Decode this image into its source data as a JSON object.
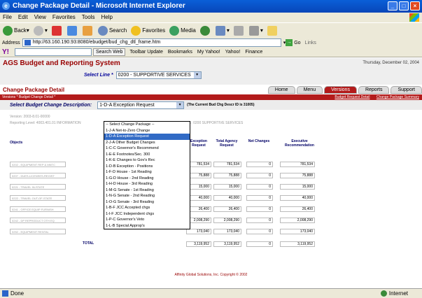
{
  "window": {
    "title": "Change Package Detail - Microsoft Internet Explorer"
  },
  "menu": [
    "File",
    "Edit",
    "View",
    "Favorites",
    "Tools",
    "Help"
  ],
  "toolbar": {
    "back": "Back",
    "search": "Search",
    "favorites": "Favorites",
    "media": "Media"
  },
  "address": {
    "label": "Address",
    "url": "http://63.160.190.93:8080/ebudget/bud_chg_dtl_frame.htm",
    "go": "Go",
    "links": "Links"
  },
  "yahoo": {
    "logo": "Y!",
    "search_web": "Search Web",
    "update": "Toolbar Update",
    "bookmarks": "Bookmarks",
    "my_yahoo": "My Yahoo!",
    "yahoo": "Yahoo!",
    "finance": "Finance"
  },
  "app": {
    "title": "AGS Budget and Reporting System",
    "date": "Thursday, December 02, 2004",
    "select_line_label": "Select Line *",
    "select_line_value": "0200 - SUPPORTIVE SERVICES",
    "page_title": "Change Package Detail",
    "tabs": [
      "Home",
      "Menu",
      "Versions",
      "Reports",
      "Support"
    ],
    "breadcrumb": "Versions * Budget Change Detail *",
    "links": [
      "Budget Request Detail",
      "Change Package Summary"
    ],
    "sbcd_label": "Select Budget Change Description:",
    "sbcd_value": "1-D-A Exception Request",
    "sbcd_note": "(The Current Bud Chg Descr ID is 31005)",
    "version": "Version: 2003-8.01-00000",
    "reporting_level": "Reporting Level: 4003.401.01  INFORMATION",
    "service_text": "E: 0200 SUPPORTIVE SERVICES",
    "col_objects": "Objects",
    "col_exception": "Exception Request",
    "col_total_agency": "Total Agency Request",
    "col_net": "Net Changes",
    "col_exec": "Executive Recommendation",
    "total_label": "TOTAL",
    "footer": "Affinity Global Solutions, Inc. Copyright © 2002"
  },
  "dropdown_options": [
    "-- Select Change Package --",
    "1-J-A Net-to-Zero Change",
    "1-D-A Exception Request",
    "2-J-A Other Budget Changes",
    "1-C-C Governor's Recommend",
    "1-E-E Footnotes/Sec. 300",
    "1-K-E Changes to Gov's Rec",
    "1-D-B Exception - Positions",
    "1-F-D House - 1st Reading",
    "1-G-D House - 2nd Reading",
    "1-H-D House - 3rd Reading",
    "1-M-G Senate - 1st Reading",
    "1-N-G Senate - 2nd Reading",
    "1-O-G Senate - 3rd Reading",
    "1-B-F JCC Accepted chgs",
    "1-I-F JCC Independent chgs",
    "1-P-C Governor's Veto",
    "1-L-B Special Approp's"
  ],
  "rows": [
    {
      "obj": "0202 - EQUIPMENT REP & MNTC",
      "exc": "781,534",
      "tar": "781,534",
      "net": "0",
      "exe": "781,534"
    },
    {
      "obj": "0207 - DUES-LICENSES-REGIST",
      "exc": "75,888",
      "tar": "75,888",
      "net": "0",
      "exe": "75,888"
    },
    {
      "obj": "0221 - TRAVEL IN-STATE",
      "exc": "15,000",
      "tar": "15,000",
      "net": "0",
      "exe": "15,000"
    },
    {
      "obj": "0222 - TRAVEL OUT-OF-STATE",
      "exc": "40,000",
      "tar": "40,000",
      "net": "0",
      "exe": "40,000"
    },
    {
      "obj": "0241 - OFFICE EQUIP FURNISH",
      "exc": "26,400",
      "tar": "26,400",
      "net": "0",
      "exe": "26,400"
    },
    {
      "obj": "0242 - DP REPRODUCT OTH EQ",
      "exc": "2,008,290",
      "tar": "2,008,290",
      "net": "0",
      "exe": "2,008,290"
    },
    {
      "obj": "0252 - EQUIPMENT RENTAL",
      "exc": "173,040",
      "tar": "173,040",
      "net": "0",
      "exe": "173,040"
    }
  ],
  "totals": {
    "exc": "3,119,952",
    "tar": "3,119,952",
    "net": "0",
    "exe": "3,119,952"
  },
  "status": {
    "left": "Done",
    "zone": "Internet"
  }
}
